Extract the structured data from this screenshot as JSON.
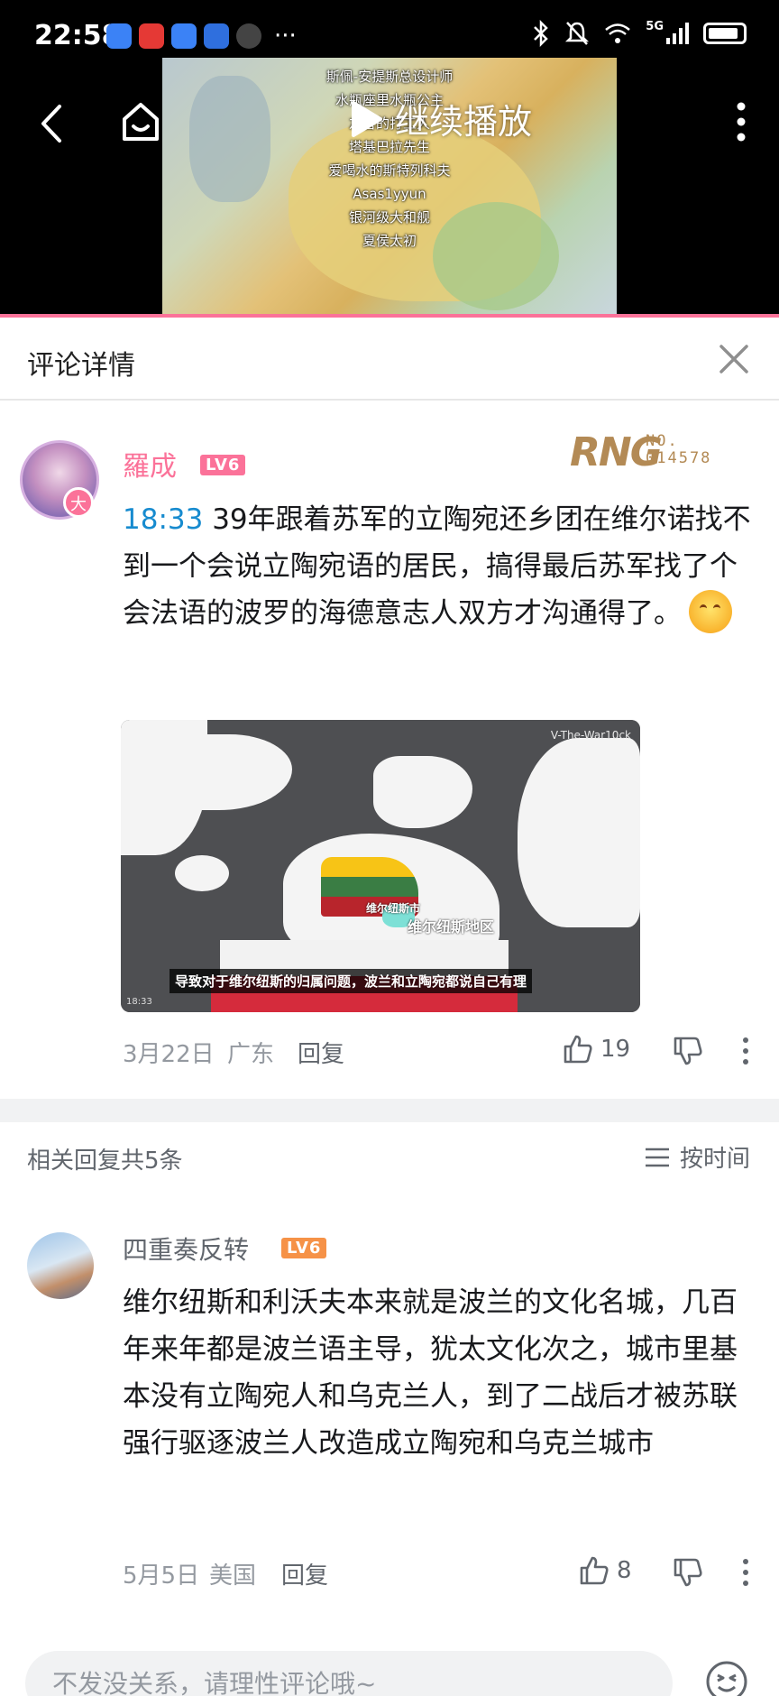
{
  "status_bar": {
    "time": "22:58",
    "network": "5G"
  },
  "video": {
    "continue_label": "继续播放",
    "danmaku": [
      "斯佩-安提斯总设计师",
      "水瓶座里水瓶公主",
      "友善的打工人",
      "塔基巴拉先生",
      "爱喝水的斯特列科夫",
      "Asas1yyun",
      "银河级大和舰",
      "夏侯太初"
    ]
  },
  "header": {
    "title": "评论详情"
  },
  "main_comment": {
    "username": "羅成",
    "level": "LV6",
    "emblem_no": "NO.\n014578",
    "emblem_logo": "RNG",
    "timestamp_link": "18:33",
    "text": " 39年跟着苏军的立陶宛还乡团在维尔诺找不到一个会说立陶宛语的居民，搞得最后苏军找了个会法语的波罗的海德意志人双方才沟通得了。",
    "image": {
      "watermark": "V-The-War10ck",
      "label_city": "维尔纽斯市",
      "label_region": "维尔纽斯地区",
      "subtitle": "导致对于维尔纽斯的归属问题，波兰和立陶宛都说自己有理",
      "time": "18:33"
    },
    "date": "3月22日",
    "location": "广东",
    "reply_label": "回复",
    "likes": "19"
  },
  "related": {
    "count_label": "相关回复共5条",
    "sort_label": "按时间"
  },
  "reply": {
    "username": "四重奏反转",
    "level": "LV6",
    "text": "维尔纽斯和利沃夫本来就是波兰的文化名城，几百年来年都是波兰语主导，犹太文化次之，城市里基本没有立陶宛人和乌克兰人，到了二战后才被苏联强行驱逐波兰人改造成立陶宛和乌克兰城市",
    "date": "5月5日",
    "location": "美国",
    "reply_label": "回复",
    "likes": "8"
  },
  "input": {
    "placeholder": "不发没关系，请理性评论哦~"
  },
  "colors": {
    "accent": "#fb7299",
    "link": "#178bcf",
    "level_main": "#fb7299",
    "level_reply": "#f69247"
  },
  "icons": [
    "back-icon",
    "home-icon",
    "play-icon",
    "more-icon",
    "close-icon",
    "thumbs-up-icon",
    "thumbs-down-icon",
    "sort-icon",
    "emoji-icon"
  ]
}
